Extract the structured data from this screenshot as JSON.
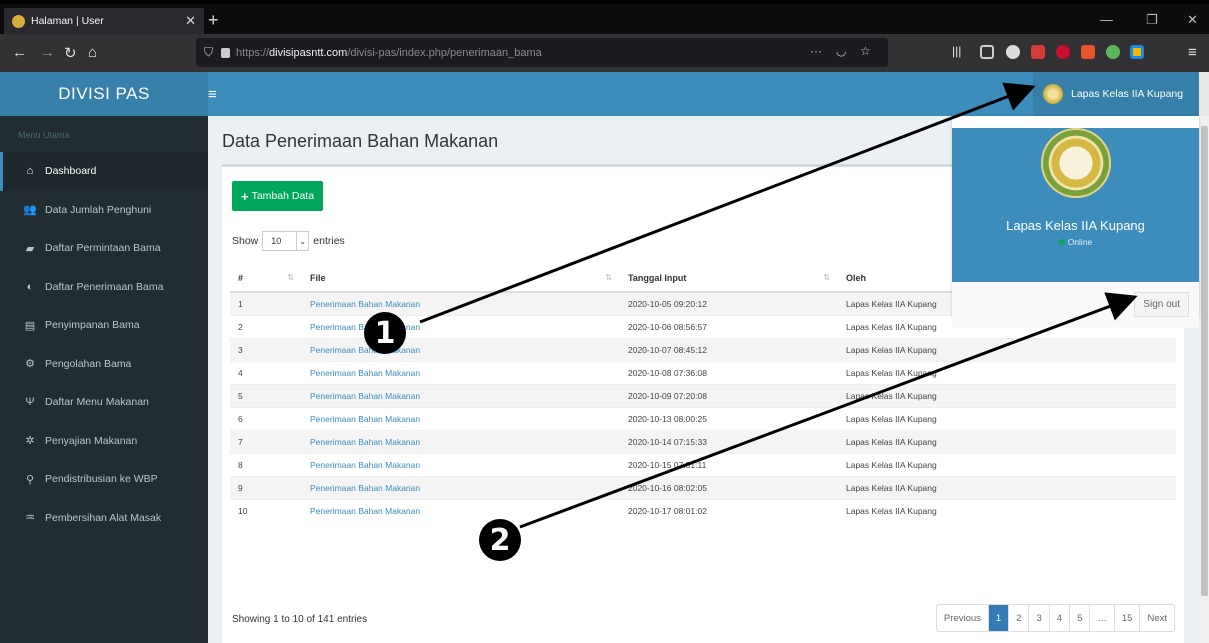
{
  "browser": {
    "tab_title": "Halaman | User",
    "url_prefix": "https://",
    "url_domain": "divisipasntt.com",
    "url_path": "/divisi-pas/index.php/penerimaan_bama"
  },
  "sidebar": {
    "brand": "DIVISI PAS",
    "menu_header": "Menu Utama",
    "items": [
      {
        "label": "Dashboard",
        "icon": "home-icon",
        "glyph": "⌂"
      },
      {
        "label": "Data Jumlah Penghuni",
        "icon": "users-icon",
        "glyph": "👥"
      },
      {
        "label": "Daftar Permintaan Bama",
        "icon": "book-icon",
        "glyph": "▰"
      },
      {
        "label": "Daftar Penerimaan Bama",
        "icon": "inbox-icon",
        "glyph": "◐"
      },
      {
        "label": "Penyimpanan Bama",
        "icon": "archive-icon",
        "glyph": "▤"
      },
      {
        "label": "Pengolahan Bama",
        "icon": "cogs-icon",
        "glyph": "⚙"
      },
      {
        "label": "Daftar Menu Makanan",
        "icon": "cutlery-icon",
        "glyph": "Ψ"
      },
      {
        "label": "Penyajian Makanan",
        "icon": "gears-icon",
        "glyph": "✲"
      },
      {
        "label": "Pendistribusian ke WBP",
        "icon": "bicycle-icon",
        "glyph": "⚲"
      },
      {
        "label": "Pembersihan Alat Masak",
        "icon": "shower-icon",
        "glyph": "♒"
      }
    ]
  },
  "header": {
    "user_name": "Lapas Kelas IIA Kupang"
  },
  "page": {
    "title": "Data Penerimaan Bahan Makanan",
    "add_button": "Tambah Data",
    "show_label": "Show",
    "entries_value": "10",
    "entries_label": "entries",
    "columns": [
      "#",
      "File",
      "Tanggal Input",
      "Oleh"
    ],
    "rows": [
      {
        "no": "1",
        "file": "Penerimaan Bahan Makanan",
        "date": "2020-10-05 09:20:12",
        "by": "Lapas Kelas IIA Kupang"
      },
      {
        "no": "2",
        "file": "Penerimaan Bahan Makanan",
        "date": "2020-10-06 08:56:57",
        "by": "Lapas Kelas IIA Kupang"
      },
      {
        "no": "3",
        "file": "Penerimaan Bahan Makanan",
        "date": "2020-10-07 08:45:12",
        "by": "Lapas Kelas IIA Kupang"
      },
      {
        "no": "4",
        "file": "Penerimaan Bahan Makanan",
        "date": "2020-10-08 07:36:08",
        "by": "Lapas Kelas IIA Kupang"
      },
      {
        "no": "5",
        "file": "Penerimaan Bahan Makanan",
        "date": "2020-10-09 07:20:08",
        "by": "Lapas Kelas IIA Kupang"
      },
      {
        "no": "6",
        "file": "Penerimaan Bahan Makanan",
        "date": "2020-10-13 08:00:25",
        "by": "Lapas Kelas IIA Kupang"
      },
      {
        "no": "7",
        "file": "Penerimaan Bahan Makanan",
        "date": "2020-10-14 07:15:33",
        "by": "Lapas Kelas IIA Kupang"
      },
      {
        "no": "8",
        "file": "Penerimaan Bahan Makanan",
        "date": "2020-10-15 07:31:11",
        "by": "Lapas Kelas IIA Kupang"
      },
      {
        "no": "9",
        "file": "Penerimaan Bahan Makanan",
        "date": "2020-10-16 08:02:05",
        "by": "Lapas Kelas IIA Kupang"
      },
      {
        "no": "10",
        "file": "Penerimaan Bahan Makanan",
        "date": "2020-10-17 08:01:02",
        "by": "Lapas Kelas IIA Kupang"
      }
    ],
    "info": "Showing 1 to 10 of 141 entries",
    "pagination": [
      "Previous",
      "1",
      "2",
      "3",
      "4",
      "5",
      "…",
      "15",
      "Next"
    ],
    "active_page": "1"
  },
  "dropdown": {
    "name": "Lapas Kelas IIA Kupang",
    "status": "Online",
    "signout": "Sign out"
  },
  "annotations": {
    "badge1": "1",
    "badge2": "2"
  },
  "colors": {
    "primary": "#3c8dbc",
    "brand": "#367fa9",
    "sidebar": "#222d32",
    "success": "#00a65a"
  }
}
